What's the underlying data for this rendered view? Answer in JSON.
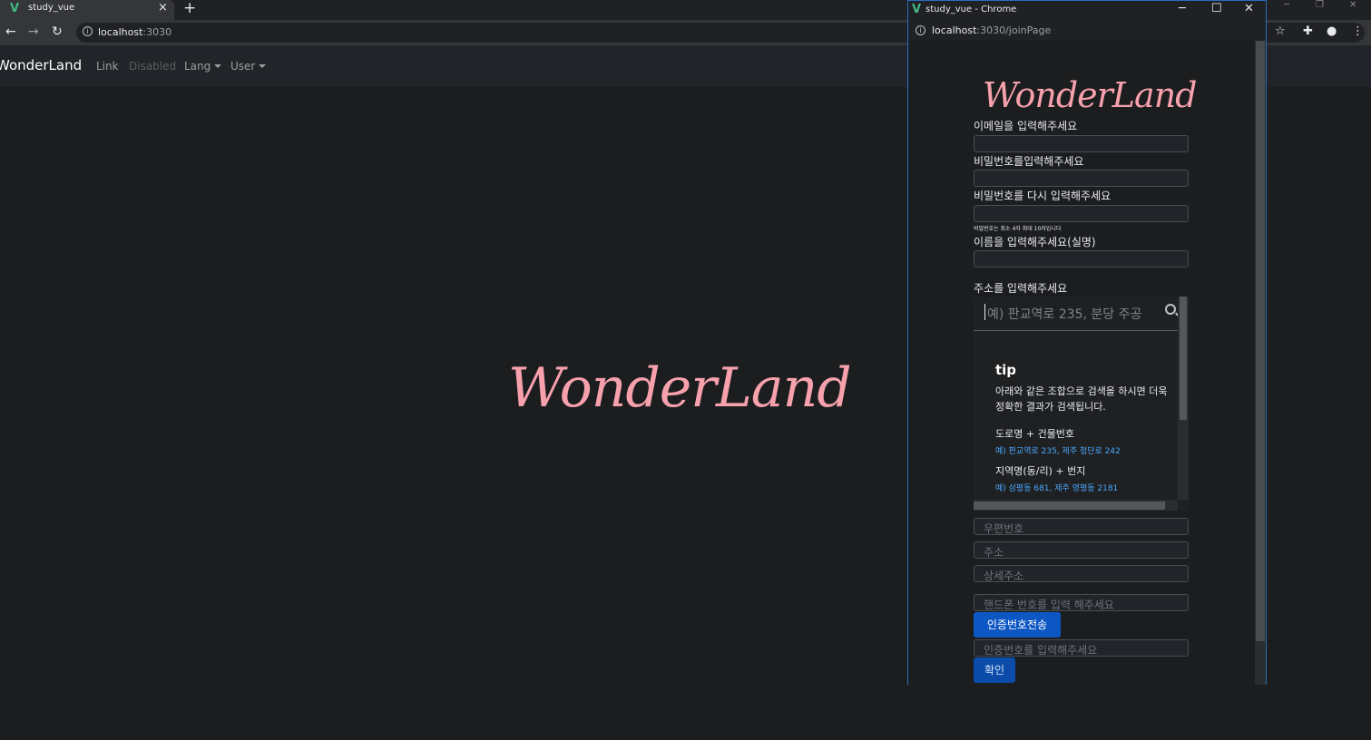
{
  "browser": {
    "tab_title": "study_vue",
    "tab_close": "×",
    "new_tab": "+",
    "url_host": "localhost",
    "url_port": ":3030"
  },
  "navbar": {
    "brand": "WonderLand",
    "link": "Link",
    "disabled": "Disabled",
    "lang": "Lang",
    "user": "User"
  },
  "hero": {
    "title": "WonderLand"
  },
  "popup": {
    "window_title": "study_vue - Chrome",
    "url_host": "localhost",
    "url_path": ":3030/joinPage",
    "logo": "WonderLand",
    "email_label": "이메일을 입력해주세요",
    "password_label": "비밀번호를입력해주세요",
    "password_confirm_label": "비밀번호를 다시 입력해주세요",
    "password_hint": "비밀번호는 최소 4자 최대 10자입니다",
    "name_label": "이름을 입력해주세요(실명)",
    "address_label": "주소를 입력해주세요",
    "address_search_placeholder": "예) 판교역로 235, 분당 주공",
    "tip": {
      "title": "tip",
      "description": "아래와 같은 조합으로 검색을 하시면 더욱 정확한 결과가 검색됩니다.",
      "road_heading": "도로명 + 건물번호",
      "road_example": "예) 판교역로 235,  제주 첨단로 242",
      "lot_heading": "지역명(동/리) + 번지",
      "lot_example": "예) 삼평동 681,  제주 영평동 2181"
    },
    "zipcode_placeholder": "우편번호",
    "address_placeholder": "주소",
    "detail_address_placeholder": "상세주소",
    "phone_placeholder": "핸드폰 번호를 입력 해주세요",
    "send_code_button": "인증번호전송",
    "code_placeholder": "인증번호를 입력해주세요",
    "confirm_button": "확인"
  }
}
